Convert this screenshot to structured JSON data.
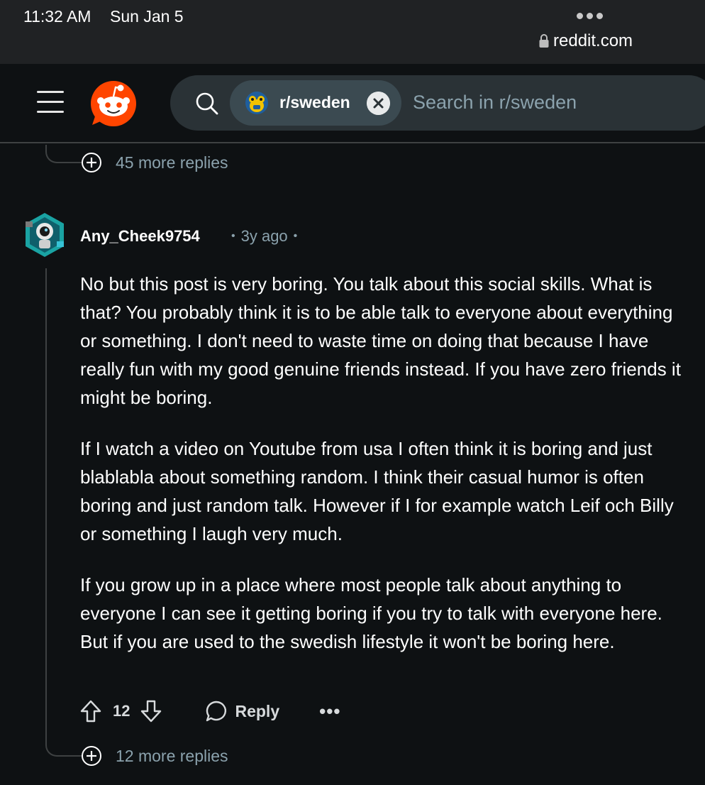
{
  "status_bar": {
    "time": "11:32 AM",
    "date": "Sun Jan 5",
    "url": "reddit.com"
  },
  "header": {
    "community_chip_label": "r/sweden",
    "search_placeholder": "Search in r/sweden"
  },
  "thread": {
    "top_more_replies": "45 more replies",
    "comment": {
      "username": "Any_Cheek9754",
      "age": "3y ago",
      "paragraphs": [
        "No but this post is very boring. You talk about this social skills. What is that? You probably think it is to be able talk to everyone about everything or something. I don't need to waste time on doing that because I have really fun with my good genuine friends instead. If you have zero friends it might be boring.",
        "If I watch a video on Youtube from usa I often think it is boring and just blablabla about something random. I think their casual humor is often boring and just random talk. However if I for example watch Leif och Billy or something I laugh very much.",
        "If you grow up in a place where most people talk about anything to everyone I can see it getting boring if you try to talk with everyone here. But if you are used to the swedish lifestyle it won't be boring here."
      ],
      "score": "12",
      "reply_label": "Reply",
      "more_label": "•••"
    },
    "bottom_more_replies": "12 more replies"
  },
  "colors": {
    "background": "#0e1113",
    "accent": "#ff4500",
    "muted_text": "#8ba2ad",
    "thread_line": "#3e4142"
  },
  "icons": [
    "lock-icon",
    "menu-icon",
    "reddit-logo",
    "search-icon",
    "close-icon",
    "plus-circle-icon",
    "upvote-icon",
    "downvote-icon",
    "comment-bubble-icon",
    "more-options-icon"
  ]
}
